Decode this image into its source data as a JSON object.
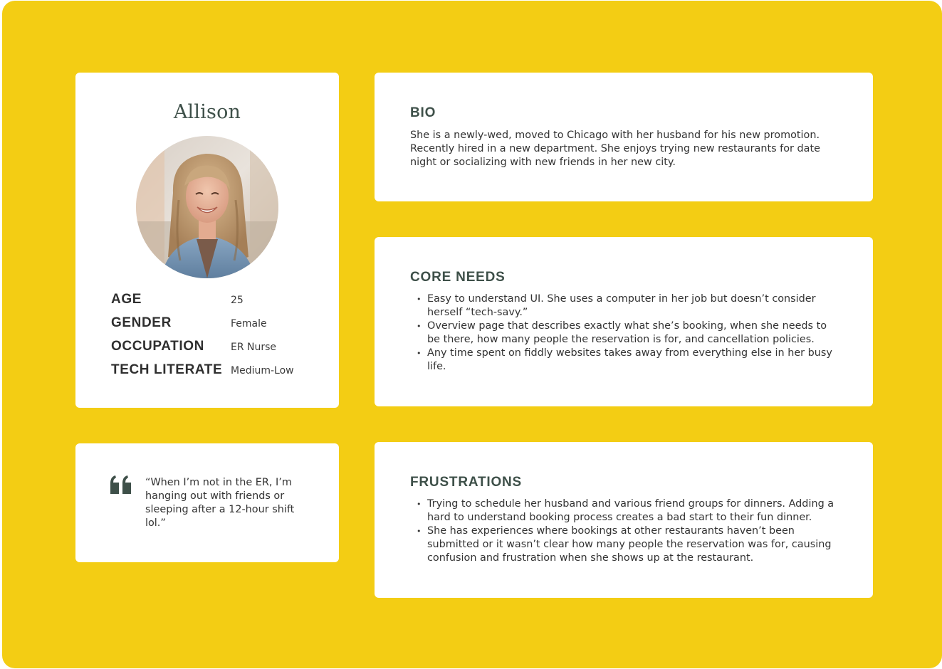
{
  "profile": {
    "name": "Allison",
    "facts": [
      {
        "label": "AGE",
        "value": "25"
      },
      {
        "label": "GENDER",
        "value": "Female"
      },
      {
        "label": "OCCUPATION",
        "value": "ER Nurse"
      },
      {
        "label": "TECH LITERATE",
        "value": "Medium-Low"
      }
    ]
  },
  "quote": {
    "icon": "quote-icon",
    "text": "“When I’m not in the ER, I’m hanging out with friends or sleeping after a 12-hour shift lol.”"
  },
  "bio": {
    "title": "BIO",
    "text": "She is a newly-wed, moved to Chicago with her husband for his new promotion. Recently hired in a new department. She enjoys trying new restaurants for date night or socializing with new friends in her new city."
  },
  "core_needs": {
    "title": "CORE NEEDS",
    "items": [
      "Easy to understand UI. She uses a computer in her job but doesn’t consider herself “tech-savy.”",
      "Overview page that describes exactly what she’s booking, when she needs to be there, how many people the reservation is for, and cancellation policies.",
      "Any time spent on fiddly websites takes away from everything else in her busy life."
    ]
  },
  "frustrations": {
    "title": "FRUSTRATIONS",
    "items": [
      "Trying to schedule her husband and various friend groups for dinners. Adding a hard to understand booking process creates a bad start to their fun dinner.",
      "She has experiences where bookings at other restaurants haven’t been submitted or it wasn’t clear how many people the reservation was for, causing confusion and frustration when she shows up at the restaurant."
    ]
  },
  "colors": {
    "background": "#f3cd14",
    "card": "#ffffff",
    "heading": "#3e5049",
    "text": "#333333"
  }
}
